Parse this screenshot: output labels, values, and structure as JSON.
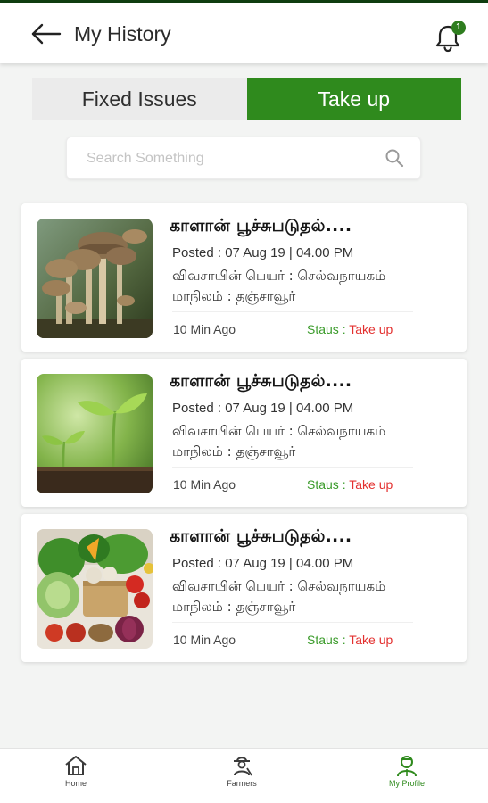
{
  "header": {
    "title": "My History",
    "notification_count": "1",
    "icons": [
      "back-arrow-icon",
      "bell-icon"
    ]
  },
  "tabs": [
    {
      "label": "Fixed Issues",
      "active": false
    },
    {
      "label": "Take up",
      "active": true
    }
  ],
  "search": {
    "placeholder": "Search Something",
    "value": "",
    "icon": "search-icon"
  },
  "cards": [
    {
      "image": "mushrooms",
      "title": "காளான் பூச்சுபடுதல்....",
      "posted": "Posted : 07 Aug 19 | 04.00 PM",
      "farmer": "விவசாயின் பெயர் : செல்வநாயகம்",
      "district": "மாநிலம் : தஞ்சாவூர்",
      "time_ago": "10 Min Ago",
      "status_label": "Staus :",
      "status_value": "Take up"
    },
    {
      "image": "seedlings",
      "title": "காளான் பூச்சுபடுதல்....",
      "posted": "Posted : 07 Aug 19 | 04.00 PM",
      "farmer": "விவசாயின் பெயர் : செல்வநாயகம்",
      "district": "மாநிலம் : தஞ்சாவூர்",
      "time_ago": "10 Min Ago",
      "status_label": "Staus :",
      "status_value": "Take up"
    },
    {
      "image": "vegetables",
      "title": "காளான் பூச்சுபடுதல்....",
      "posted": "Posted : 07 Aug 19 | 04.00 PM",
      "farmer": "விவசாயின் பெயர் : செல்வநாயகம்",
      "district": "மாநிலம் : தஞ்சாவூர்",
      "time_ago": "10 Min Ago",
      "status_label": "Staus :",
      "status_value": "Take up"
    }
  ],
  "bottom_nav": [
    {
      "label": "Home",
      "icon": "home-icon",
      "active": false
    },
    {
      "label": "Farmers",
      "icon": "farmer-icon",
      "active": false
    },
    {
      "label": "My Profile",
      "icon": "profile-icon",
      "active": true
    }
  ],
  "colors": {
    "accent_green": "#2f8a1d",
    "status_red": "#e3302f",
    "status_label_green": "#3a9b2a"
  }
}
